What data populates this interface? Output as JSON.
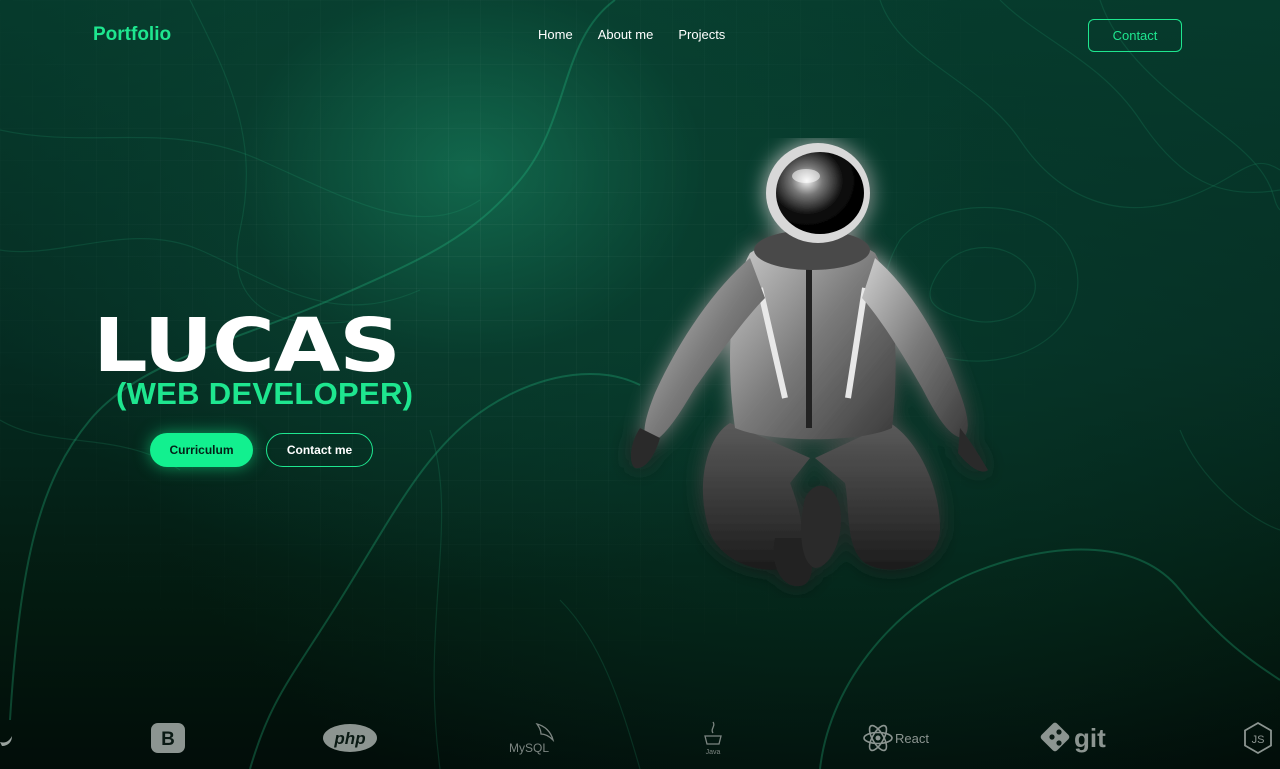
{
  "brand": {
    "logo": "Portfolio"
  },
  "nav": {
    "items": [
      "Home",
      "About me",
      "Projects"
    ],
    "contact_label": "Contact"
  },
  "hero": {
    "name": "LUCAS",
    "role": "(WEB DEVELOPER)",
    "primary_button": "Curriculum",
    "secondary_button": "Contact me",
    "image": "astronaut-image"
  },
  "tech": {
    "bootstrap": {
      "icon": "bootstrap-icon",
      "letter": "B"
    },
    "php": {
      "icon": "php-icon",
      "label": "php"
    },
    "mysql": {
      "icon": "mysql-icon",
      "label": "MySQL"
    },
    "java": {
      "icon": "java-icon",
      "label": "Java"
    },
    "react": {
      "icon": "react-icon",
      "label": "React"
    },
    "git": {
      "icon": "git-icon",
      "label": "git"
    },
    "nodejs": {
      "icon": "nodejs-icon",
      "label": "JS"
    }
  },
  "colors": {
    "accent": "#1ee68f",
    "button_fill": "#12f08f",
    "bg_dark": "#03190f",
    "bg_glow": "#167858"
  }
}
